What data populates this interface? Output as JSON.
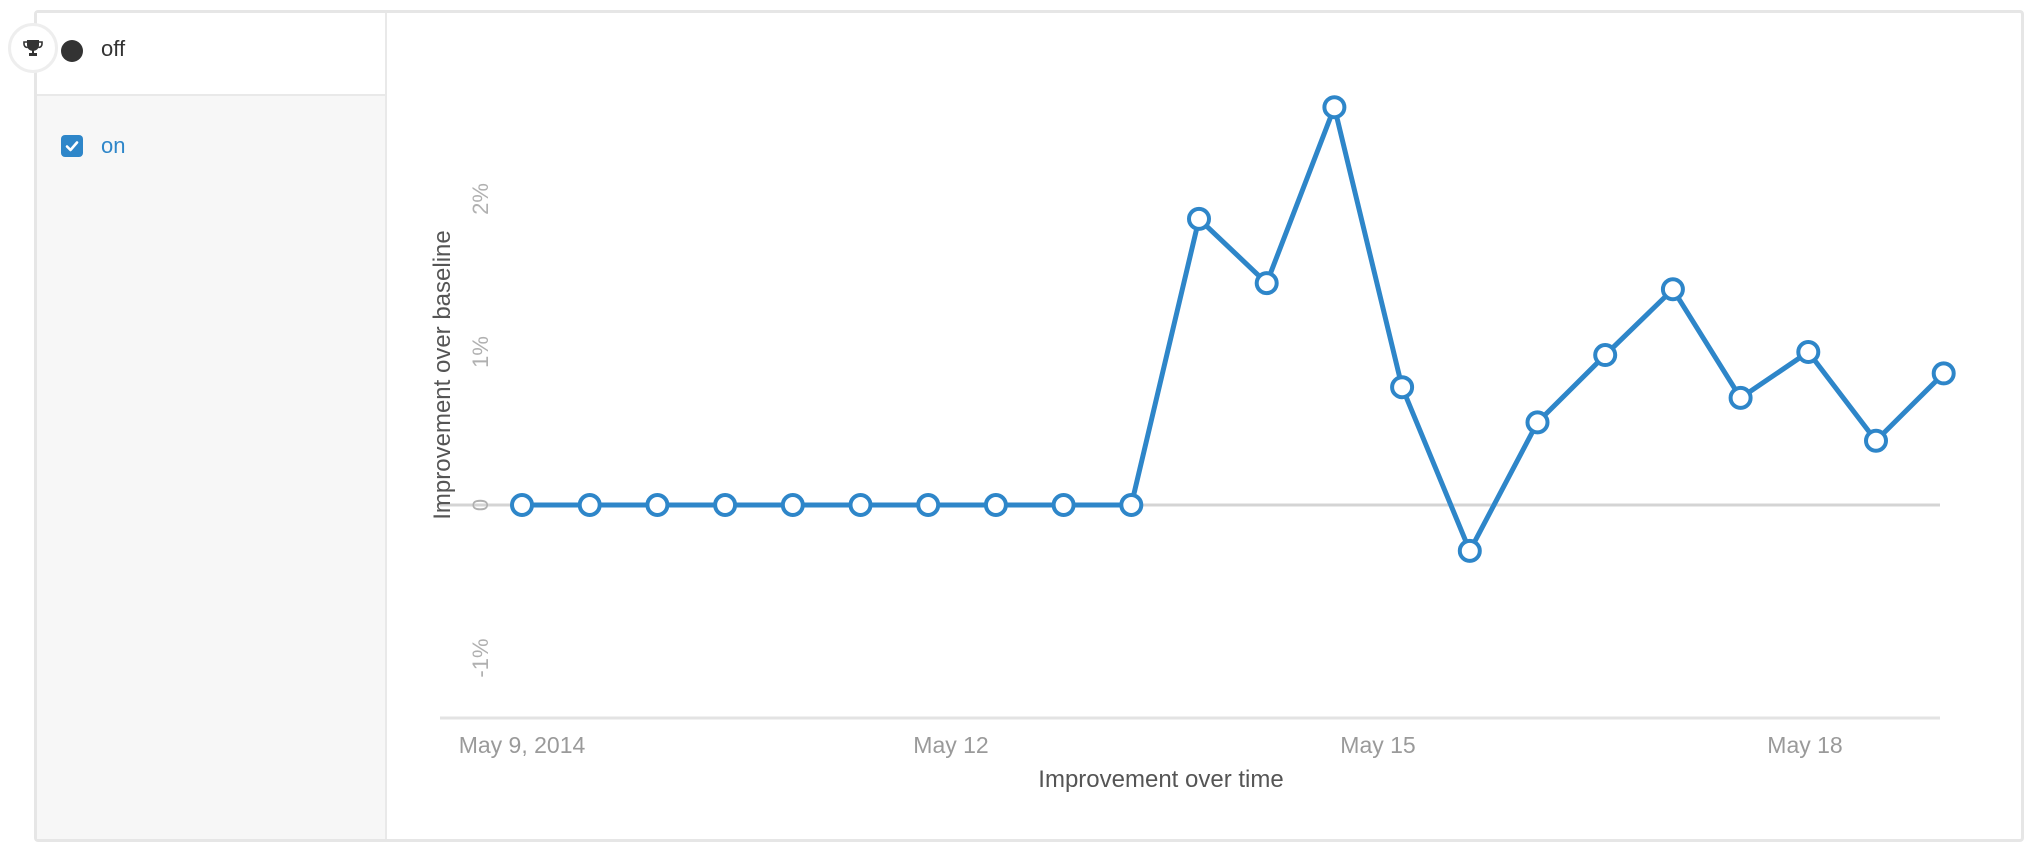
{
  "variations": [
    {
      "label": "off",
      "color": "#333333",
      "icon": "trophy-icon",
      "marker": "filled-dot",
      "selected": false
    },
    {
      "label": "on",
      "color": "#2e86c9",
      "marker": "checkbox",
      "selected": true
    }
  ],
  "chart_data": {
    "type": "line",
    "title": "",
    "xlabel": "Improvement over time",
    "ylabel": "Improvement over baseline",
    "x_tick_labels": [
      "May 9, 2014",
      "May 12",
      "May 15",
      "May 18"
    ],
    "y_tick_labels": [
      "-1%",
      "0",
      "1%",
      "2%"
    ],
    "ylim": [
      -1.4,
      2.6
    ],
    "grid": false,
    "x": [
      "2014-05-09",
      "2014-05-09",
      "2014-05-10",
      "2014-05-10",
      "2014-05-11",
      "2014-05-11",
      "2014-05-12",
      "2014-05-12",
      "2014-05-13",
      "2014-05-13",
      "2014-05-14",
      "2014-05-14",
      "2014-05-15",
      "2014-05-15",
      "2014-05-16",
      "2014-05-16",
      "2014-05-17",
      "2014-05-17",
      "2014-05-18",
      "2014-05-18",
      "2014-05-19",
      "2014-05-19"
    ],
    "series": [
      {
        "name": "on",
        "color": "#2e86c9",
        "values": [
          0,
          0,
          0,
          0,
          0,
          0,
          0,
          0,
          0,
          0,
          1.87,
          1.45,
          2.6,
          0.77,
          -0.3,
          0.54,
          0.98,
          1.41,
          0.7,
          1.0,
          0.42,
          0.86
        ]
      }
    ]
  }
}
